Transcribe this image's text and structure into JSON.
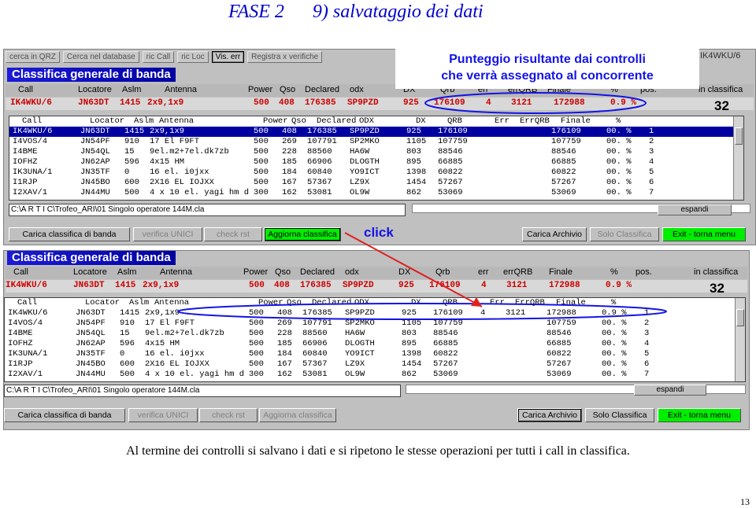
{
  "slide": {
    "phase": "FASE 2",
    "title": "9) salvataggio dei dati",
    "caption": "Al termine dei controlli si salvano i dati e si ripetono le stesse operazioni per tutti i call in classifica.",
    "page_number": "13"
  },
  "annotations": {
    "callout_line1": "Punteggio risultante dai controlli",
    "callout_line2": "che verrà assegnato al concorrente",
    "click_label": "click"
  },
  "toolbar": [
    "cerca in QRZ",
    "Cerca nel database",
    "ric Call",
    "ric Loc",
    "Vis. err",
    "Registra x verifiche"
  ],
  "toolbar_right": "IK4WKU/6",
  "section_title": "Classifica generale di banda",
  "header_cols": [
    "Call",
    "Locatore",
    "Aslm",
    "Antenna",
    "Power",
    "Qso",
    "Declared",
    "odx",
    "DX",
    "Qrb",
    "err",
    "errQRB",
    "Finale",
    "%",
    "pos.",
    "in classifica"
  ],
  "best": [
    "IK4WKU/6",
    "JN63DT",
    "1415",
    "2x9,1x9",
    "500",
    "408",
    "176385",
    "SP9PZD",
    "925",
    "176109",
    "4",
    "3121",
    "172988",
    "0.9 %"
  ],
  "count": "32",
  "grid1": {
    "head": [
      "Call",
      "Locator",
      "Aslm",
      "Antenna",
      "Power",
      "Qso",
      "Declared",
      "ODX",
      "DX",
      "QRB",
      "Err",
      "ErrQRB",
      "Finale",
      "%"
    ],
    "rows": [
      [
        "IK4WKU/6",
        "JN63DT",
        "1415",
        "2x9,1x9",
        "500",
        "408",
        "176385",
        "SP9PZD",
        "925",
        "176109",
        "",
        "",
        "176109",
        "00. %",
        "1"
      ],
      [
        "I4VOS/4",
        "JN54PF",
        "910",
        "17 El F9FT",
        "500",
        "269",
        "107791",
        "SP2MKO",
        "1105",
        "107759",
        "",
        "",
        "107759",
        "00. %",
        "2"
      ],
      [
        "I4BME",
        "JN54QL",
        "15",
        "9el.m2+7el.dk7zb",
        "500",
        "228",
        "88560",
        "HA6W",
        "803",
        "88546",
        "",
        "",
        "88546",
        "00. %",
        "3"
      ],
      [
        "IOFHZ",
        "JN62AP",
        "596",
        "4x15 HM",
        "500",
        "185",
        "66906",
        "DLOGTH",
        "895",
        "66885",
        "",
        "",
        "66885",
        "00. %",
        "4"
      ],
      [
        "IK3UNA/1",
        "JN35TF",
        "0",
        "16 el. i0jxx",
        "500",
        "184",
        "60840",
        "YO9ICT",
        "1398",
        "60822",
        "",
        "",
        "60822",
        "00. %",
        "5"
      ],
      [
        "I1RJP",
        "JN45BO",
        "600",
        "2X16 EL IOJXX",
        "500",
        "167",
        "57367",
        "LZ9X",
        "1454",
        "57267",
        "",
        "",
        "57267",
        "00. %",
        "6"
      ],
      [
        "I2XAV/1",
        "JN44MU",
        "500",
        "4 x 10 el. yagi hm d",
        "300",
        "162",
        "53081",
        "OL9W",
        "862",
        "53069",
        "",
        "",
        "53069",
        "00. %",
        "7"
      ]
    ]
  },
  "grid2": {
    "head": [
      "Call",
      "Locator",
      "Aslm",
      "Antenna",
      "Power",
      "Qso",
      "Declared",
      "ODX",
      "DX",
      "QRB",
      "Err",
      "ErrQRB",
      "Finale",
      "%"
    ],
    "rows": [
      [
        "IK4WKU/6",
        "JN63DT",
        "1415",
        "2x9,1x9",
        "500",
        "408",
        "176385",
        "SP9PZD",
        "925",
        "176109",
        "4",
        "3121",
        "172988",
        "0.9 %",
        "1"
      ],
      [
        "I4VOS/4",
        "JN54PF",
        "910",
        "17 El F9FT",
        "500",
        "269",
        "107791",
        "SP2MKO",
        "1105",
        "107759",
        "",
        "",
        "107759",
        "00. %",
        "2"
      ],
      [
        "I4BME",
        "JN54QL",
        "15",
        "9el.m2+7el.dk7zb",
        "500",
        "228",
        "88560",
        "HA6W",
        "803",
        "88546",
        "",
        "",
        "88546",
        "00. %",
        "3"
      ],
      [
        "IOFHZ",
        "JN62AP",
        "596",
        "4x15 HM",
        "500",
        "185",
        "66906",
        "DLOGTH",
        "895",
        "66885",
        "",
        "",
        "66885",
        "00. %",
        "4"
      ],
      [
        "IK3UNA/1",
        "JN35TF",
        "0",
        "16 el. i0jxx",
        "500",
        "184",
        "60840",
        "YO9ICT",
        "1398",
        "60822",
        "",
        "",
        "60822",
        "00. %",
        "5"
      ],
      [
        "I1RJP",
        "JN45BO",
        "600",
        "2X16 EL IOJXX",
        "500",
        "167",
        "57367",
        "LZ9X",
        "1454",
        "57267",
        "",
        "",
        "57267",
        "00. %",
        "6"
      ],
      [
        "I2XAV/1",
        "JN44MU",
        "500",
        "4 x 10 el. yagi hm d",
        "300",
        "162",
        "53081",
        "OL9W",
        "862",
        "53069",
        "",
        "",
        "53069",
        "00. %",
        "7"
      ]
    ]
  },
  "path": "C:\\A R T I C\\Trofeo_ARI\\01 Singolo operatore 144M.cla",
  "espandi": "espandi",
  "buttons1": {
    "carica": "Carica classifica di banda",
    "verifica": "verifica UNICI",
    "check": "check rst",
    "aggiorna": "Aggiorna classifica",
    "archivio": "Carica Archivio",
    "solo": "Solo Classifica",
    "exit": "Exit - torna menu"
  },
  "buttons2": {
    "carica": "Carica classifica di banda",
    "verifica": "verifica UNICI",
    "check": "check rst",
    "aggiorna": "Aggiorna classifica",
    "archivio": "Carica Archivio",
    "solo": "Solo Classifica",
    "exit": "Exit - torna menu"
  },
  "colors": {
    "title_blue": "#0000cc",
    "annotation_blue": "#1414e6",
    "arrow_red": "#e02020",
    "selection": "#0000a0",
    "button_green": "#00ee00",
    "best_red": "#cc0000"
  }
}
